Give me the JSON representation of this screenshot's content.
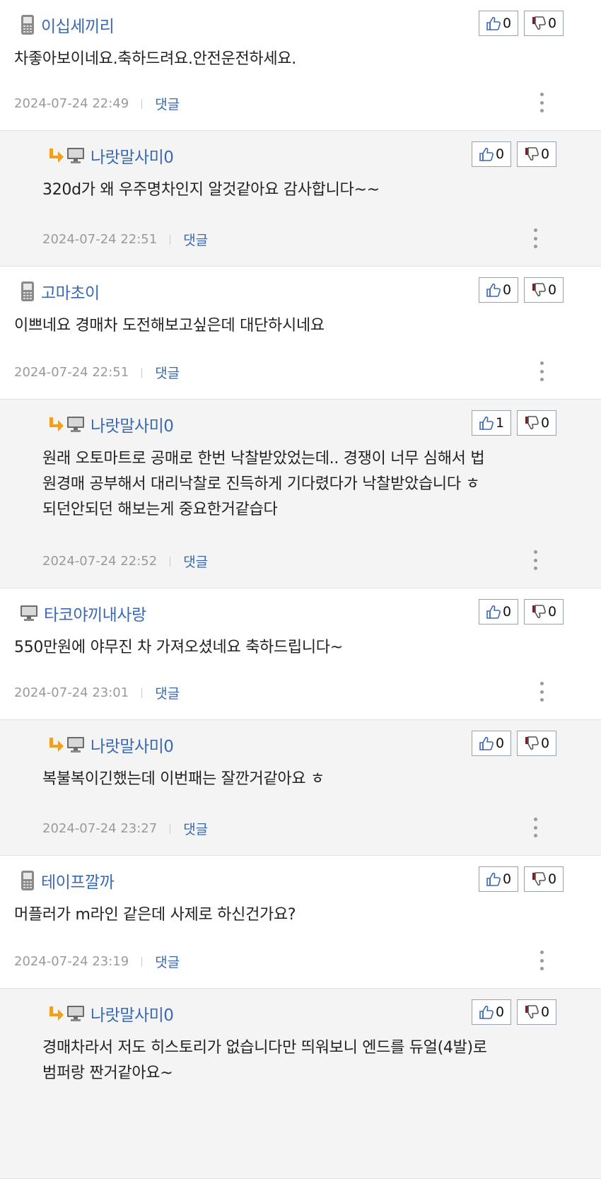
{
  "comments": [
    {
      "nick": "이십세끼리",
      "text": [
        "차좋아보이네요.축하드려요.안전운전하세요."
      ],
      "time": "2024-07-24 22:49",
      "reply_label": "댓글",
      "likes": "0",
      "dislikes": "0",
      "device": "phone-icon",
      "is_reply": false
    },
    {
      "nick": "나랏말사미0",
      "text": [
        "320d가 왜 우주명차인지 알것같아요 감사합니다~~"
      ],
      "time": "2024-07-24 22:51",
      "reply_label": "댓글",
      "likes": "0",
      "dislikes": "0",
      "device": "monitor-icon",
      "is_reply": true
    },
    {
      "nick": "고마초이",
      "text": [
        "이쁘네요 경매차 도전해보고싶은데 대단하시네요"
      ],
      "time": "2024-07-24 22:51",
      "reply_label": "댓글",
      "likes": "0",
      "dislikes": "0",
      "device": "phone-icon",
      "is_reply": false
    },
    {
      "nick": "나랏말사미0",
      "text": [
        "원래 오토마트로 공매로 한번 낙찰받았었는데.. 경쟁이 너무 심해서 법",
        "원경매 공부해서 대리낙찰로 진득하게 기다렸다가 낙찰받았습니다 ㅎ",
        "되던안되던 해보는게 중요한거같습다"
      ],
      "time": "2024-07-24 22:52",
      "reply_label": "댓글",
      "likes": "1",
      "dislikes": "0",
      "device": "monitor-icon",
      "is_reply": true
    },
    {
      "nick": "타코야끼내사랑",
      "text": [
        "550만원에 야무진 차 가져오셨네요 축하드립니다~"
      ],
      "time": "2024-07-24 23:01",
      "reply_label": "댓글",
      "likes": "0",
      "dislikes": "0",
      "device": "monitor-icon",
      "is_reply": false
    },
    {
      "nick": "나랏말사미0",
      "text": [
        "복불복이긴했는데 이번패는 잘깐거같아요 ㅎ"
      ],
      "time": "2024-07-24 23:27",
      "reply_label": "댓글",
      "likes": "0",
      "dislikes": "0",
      "device": "monitor-icon",
      "is_reply": true
    },
    {
      "nick": "테이프깔까",
      "text": [
        "머플러가 m라인 같은데 사제로 하신건가요?"
      ],
      "time": "2024-07-24 23:19",
      "reply_label": "댓글",
      "likes": "0",
      "dislikes": "0",
      "device": "phone-icon",
      "is_reply": false
    },
    {
      "nick": "나랏말사미0",
      "text": [
        "경매차라서 저도 히스토리가 없습니다만 띄워보니 엔드를 듀얼(4발)로",
        "범퍼랑 짠거같아요~"
      ],
      "time": "",
      "reply_label": "",
      "likes": "0",
      "dislikes": "0",
      "device": "monitor-icon",
      "is_reply": true
    }
  ],
  "colors": {
    "nick": "#3a69b3",
    "reply_bg": "#f4f4f4",
    "arrow": "#f0a020",
    "thumb_up": "#3a69b3",
    "thumb_down": "#8a1a1a"
  }
}
